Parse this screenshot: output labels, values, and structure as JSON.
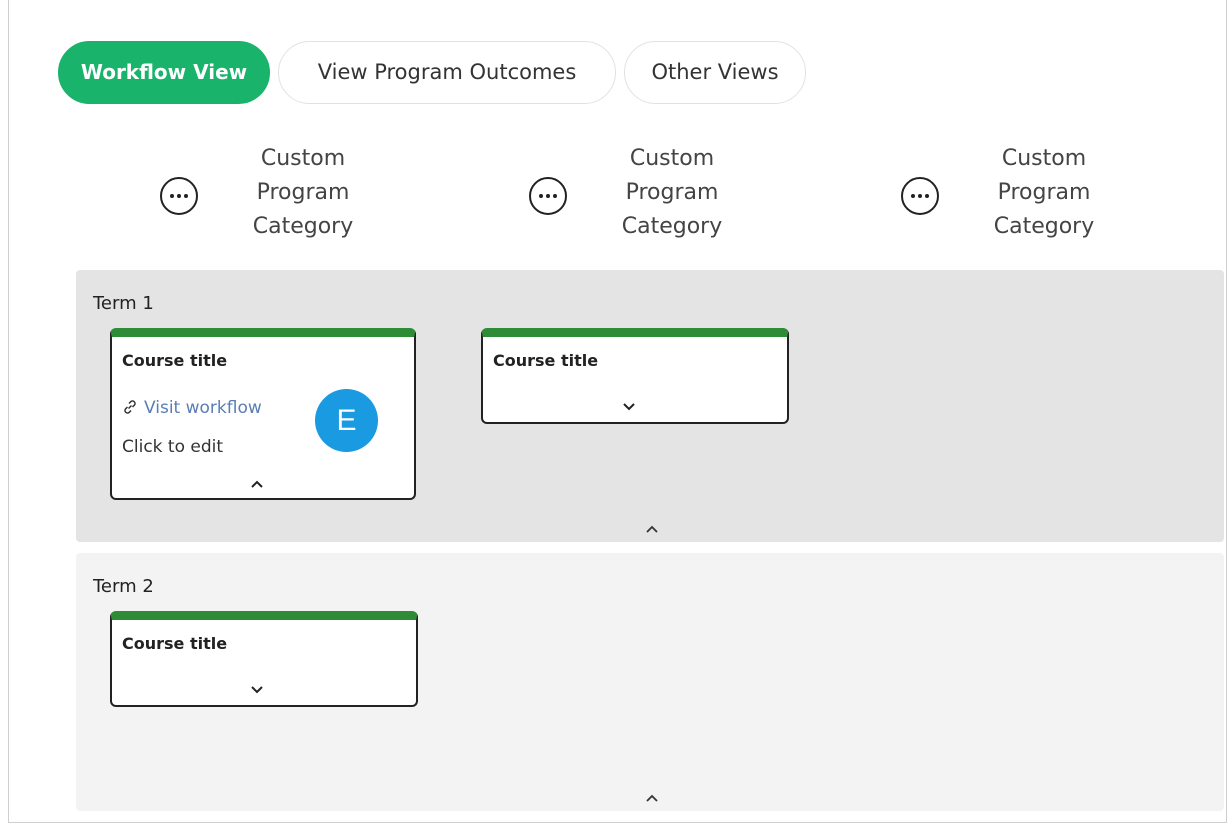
{
  "tabs": [
    {
      "label": "Workflow View",
      "active": true
    },
    {
      "label": "View Program Outcomes",
      "active": false
    },
    {
      "label": "Other Views",
      "active": false
    }
  ],
  "categories": [
    {
      "label": "Custom Program Category",
      "icon": "more-icon"
    },
    {
      "label": "Custom Program Category",
      "icon": "more-icon"
    },
    {
      "label": "Custom Program Category",
      "icon": "more-icon"
    }
  ],
  "terms": [
    {
      "title": "Term 1",
      "courses": [
        {
          "title": "Course title",
          "expanded": true,
          "link_label": "Visit workflow",
          "edit_label": "Click to edit",
          "badge": "E"
        },
        {
          "title": "Course title",
          "expanded": false
        }
      ]
    },
    {
      "title": "Term 2",
      "courses": [
        {
          "title": "Course title",
          "expanded": false
        }
      ]
    }
  ],
  "colors": {
    "accent": "#19b36b",
    "card_top": "#2e8b36",
    "link": "#5a7db5",
    "badge": "#1a9ae0",
    "term1_bg": "#e4e4e4",
    "term2_bg": "#f3f3f3"
  }
}
